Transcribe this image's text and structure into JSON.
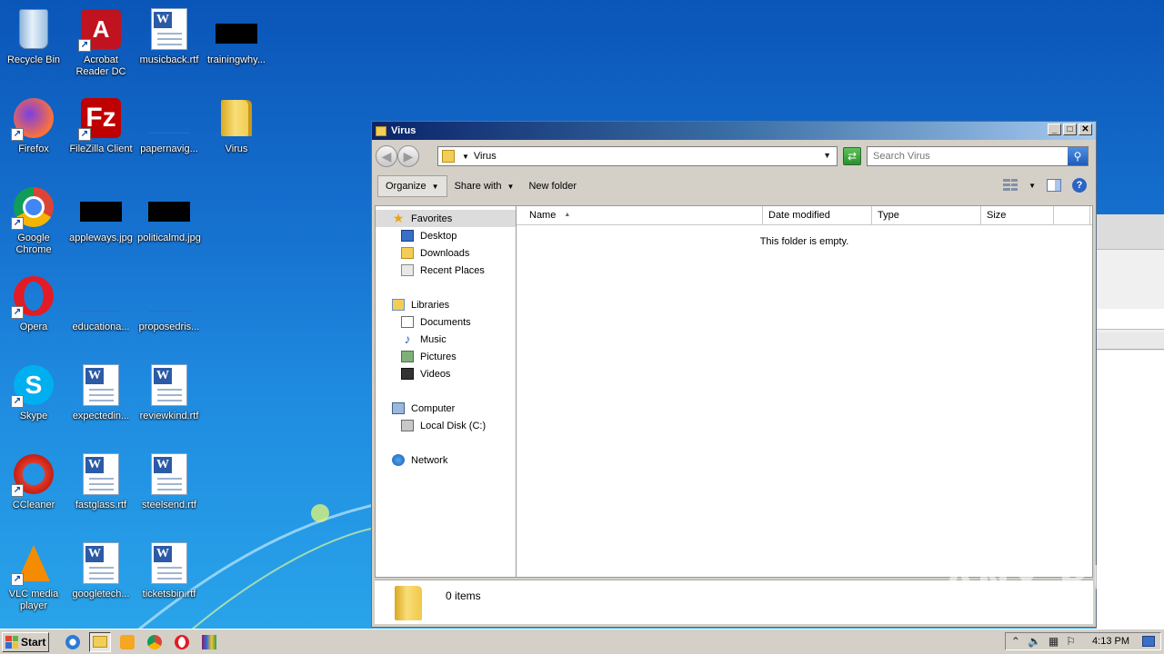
{
  "desktop": {
    "icons": [
      {
        "label": "Recycle Bin"
      },
      {
        "label": "Acrobat Reader DC"
      },
      {
        "label": "musicback.rtf"
      },
      {
        "label": "trainingwhy..."
      },
      {
        "label": "Firefox"
      },
      {
        "label": "FileZilla Client"
      },
      {
        "label": "papernavig..."
      },
      {
        "label": "Virus"
      },
      {
        "label": "Google Chrome"
      },
      {
        "label": "appleways.jpg"
      },
      {
        "label": "politicalmd.jpg"
      },
      {
        "label": "Opera"
      },
      {
        "label": "educationa..."
      },
      {
        "label": "proposedris..."
      },
      {
        "label": "Skype"
      },
      {
        "label": "expectedin..."
      },
      {
        "label": "reviewkind.rtf"
      },
      {
        "label": "CCleaner"
      },
      {
        "label": "fastglass.rtf"
      },
      {
        "label": "steelsend.rtf"
      },
      {
        "label": "VLC media player"
      },
      {
        "label": "googletech..."
      },
      {
        "label": "ticketsbin.rtf"
      }
    ]
  },
  "window": {
    "title": "Virus",
    "address": "Virus",
    "search_placeholder": "Search Virus",
    "toolbar": {
      "organize": "Organize",
      "share_with": "Share with",
      "new_folder": "New folder"
    },
    "nav": {
      "favorites": "Favorites",
      "desktop": "Desktop",
      "downloads": "Downloads",
      "recent_places": "Recent Places",
      "libraries": "Libraries",
      "documents": "Documents",
      "music": "Music",
      "pictures": "Pictures",
      "videos": "Videos",
      "computer": "Computer",
      "local_disk": "Local Disk (C:)",
      "network": "Network"
    },
    "columns": {
      "name": "Name",
      "date_modified": "Date modified",
      "type": "Type",
      "size": "Size"
    },
    "empty_message": "This folder is empty.",
    "details_count": "0 items"
  },
  "taskbar": {
    "start_label": "Start",
    "clock": "4:13 PM"
  },
  "watermark": "ANY RUN"
}
